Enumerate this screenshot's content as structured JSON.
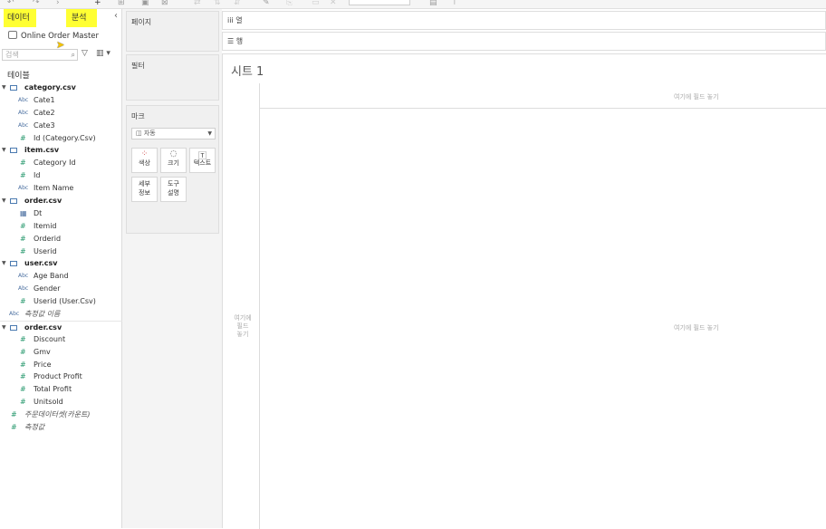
{
  "toolbar": {
    "icons": [
      "undo-icon",
      "redo-icon",
      "new-sheet-icon",
      "duplicate-icon",
      "clear-icon",
      "swap-icon",
      "sort-icon",
      "highlight-icon",
      "presentation-icon"
    ]
  },
  "left_panel": {
    "tabs": {
      "data": "데이터",
      "analysis": "분석"
    },
    "datasource": "Online Order Master",
    "search_placeholder": "검색",
    "tables_label": "테이블",
    "tables": [
      {
        "name": "category.csv",
        "fields": [
          {
            "type": "Abc",
            "name": "Cate1"
          },
          {
            "type": "Abc",
            "name": "Cate2"
          },
          {
            "type": "Abc",
            "name": "Cate3"
          },
          {
            "type": "#",
            "name": "Id (Category.Csv)"
          }
        ]
      },
      {
        "name": "item.csv",
        "fields": [
          {
            "type": "#",
            "name": "Category Id"
          },
          {
            "type": "#",
            "name": "Id"
          },
          {
            "type": "Abc",
            "name": "Item Name"
          }
        ]
      },
      {
        "name": "order.csv",
        "fields": [
          {
            "type": "date",
            "name": "Dt"
          },
          {
            "type": "#",
            "name": "Itemid"
          },
          {
            "type": "#",
            "name": "Orderid"
          },
          {
            "type": "#",
            "name": "Userid"
          }
        ]
      },
      {
        "name": "user.csv",
        "fields": [
          {
            "type": "Abc",
            "name": "Age Band"
          },
          {
            "type": "Abc",
            "name": "Gender"
          },
          {
            "type": "#",
            "name": "Userid (User.Csv)"
          }
        ]
      }
    ],
    "measure_names": "측정값 이름",
    "measure_table": {
      "name": "order.csv",
      "fields": [
        "Discount",
        "Gmv",
        "Price",
        "Product Profit",
        "Total Profit",
        "Unitsold"
      ]
    },
    "count_field": "주문데이터셋(카운트)",
    "measure_values": "측정값"
  },
  "cards": {
    "pages": "페이지",
    "filters": "필터",
    "marks": "마크",
    "marks_type": "자동",
    "mark_buttons": [
      {
        "label": "색상",
        "icon": "color-icon"
      },
      {
        "label": "크기",
        "icon": "size-icon"
      },
      {
        "label": "텍스트",
        "icon": "text-icon"
      },
      {
        "label1": "세부",
        "label2": "정보",
        "icon": "detail-icon"
      },
      {
        "label1": "도구",
        "label2": "설명",
        "icon": "tooltip-icon"
      }
    ]
  },
  "shelves": {
    "columns": "열",
    "rows": "행"
  },
  "sheet": {
    "title": "시트 1",
    "drop_top": "여기에 필드 놓기",
    "drop_center": "여기에 필드 놓기",
    "drop_left_lines": [
      "여기에",
      "필드",
      "놓기"
    ]
  },
  "colors": {
    "highlight": "#ffff33",
    "dimension": "#4a6fa0",
    "measure": "#2a9a6f"
  }
}
